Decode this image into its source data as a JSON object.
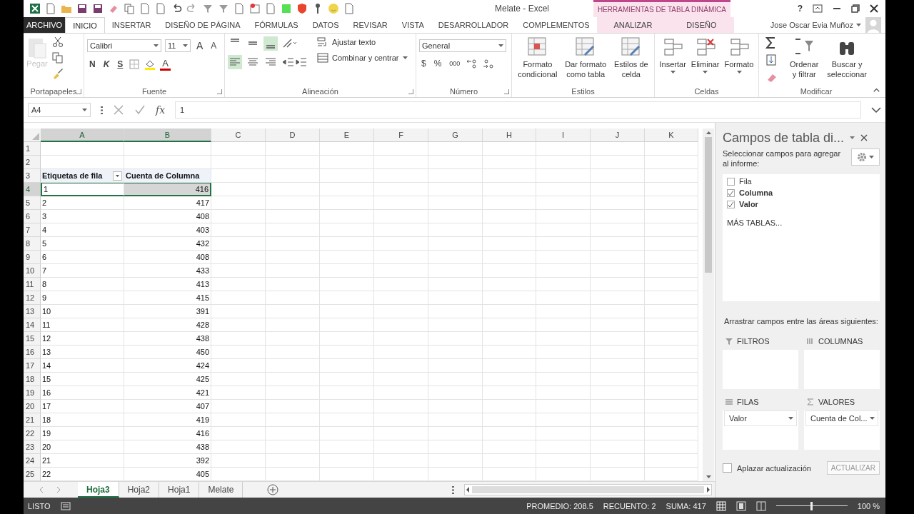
{
  "title_bar": {
    "title": "Melate - Excel",
    "context_group": "HERRAMIENTAS DE TABLA DINÁMICA",
    "help": "?"
  },
  "tabs": [
    {
      "label": "ARCHIVO",
      "kind": "file",
      "selected": false
    },
    {
      "label": "INICIO",
      "kind": "tab",
      "selected": true
    },
    {
      "label": "INSERTAR",
      "kind": "tab",
      "selected": false
    },
    {
      "label": "DISEÑO DE PÁGINA",
      "kind": "tab",
      "selected": false
    },
    {
      "label": "FÓRMULAS",
      "kind": "tab",
      "selected": false
    },
    {
      "label": "DATOS",
      "kind": "tab",
      "selected": false
    },
    {
      "label": "REVISAR",
      "kind": "tab",
      "selected": false
    },
    {
      "label": "VISTA",
      "kind": "tab",
      "selected": false
    },
    {
      "label": "DESARROLLADOR",
      "kind": "tab",
      "selected": false
    },
    {
      "label": "COMPLEMENTOS",
      "kind": "tab",
      "selected": false
    },
    {
      "label": "ANALIZAR",
      "kind": "contextual",
      "selected": false
    },
    {
      "label": "DISEÑO",
      "kind": "contextual",
      "selected": false
    }
  ],
  "user": "Jose Oscar Evia Muñoz",
  "ribbon": {
    "clipboard": {
      "label": "Portapapeles",
      "paste": "Pegar",
      "paste_disabled": true
    },
    "font": {
      "label": "Fuente",
      "family": "Calibri",
      "size": "11",
      "grow": "A",
      "shrink": "A",
      "bold": "N",
      "italic": "K",
      "underline": "S",
      "font_color_letter": "A"
    },
    "alignment": {
      "label": "Alineación",
      "wrap": "Ajustar texto",
      "merge": "Combinar y centrar",
      "vertical": [
        {
          "selected": false
        },
        {
          "selected": false
        },
        {
          "selected": true
        }
      ],
      "horizontal": [
        {
          "selected": true
        },
        {
          "selected": false
        },
        {
          "selected": false
        }
      ]
    },
    "number": {
      "label": "Número",
      "format": "General",
      "currency": "$",
      "percent": "%",
      "thousands": "000"
    },
    "styles": {
      "label": "Estilos",
      "buttons": [
        {
          "lines": [
            "Formato",
            "condicional"
          ]
        },
        {
          "lines": [
            "Dar formato",
            "como tabla"
          ]
        },
        {
          "lines": [
            "Estilos de",
            "celda"
          ]
        }
      ]
    },
    "cells": {
      "label": "Celdas",
      "buttons": [
        {
          "lines": [
            "Insertar"
          ]
        },
        {
          "lines": [
            "Eliminar"
          ]
        },
        {
          "lines": [
            "Formato"
          ]
        }
      ]
    },
    "editing": {
      "label": "Modificar",
      "buttons": [
        {
          "lines": [
            "Ordenar",
            "y filtrar"
          ]
        },
        {
          "lines": [
            "Buscar y",
            "seleccionar"
          ]
        }
      ]
    }
  },
  "formula_bar": {
    "name_box": "A4",
    "fx": "fx",
    "value": "1"
  },
  "grid": {
    "columns": [
      {
        "label": "A",
        "selected": true
      },
      {
        "label": "B",
        "selected": true
      },
      {
        "label": "C",
        "selected": false
      },
      {
        "label": "D",
        "selected": false
      },
      {
        "label": "E",
        "selected": false
      },
      {
        "label": "F",
        "selected": false
      },
      {
        "label": "G",
        "selected": false
      },
      {
        "label": "H",
        "selected": false
      },
      {
        "label": "I",
        "selected": false
      },
      {
        "label": "J",
        "selected": false
      },
      {
        "label": "K",
        "selected": false
      }
    ],
    "rows": [
      {
        "number": "1",
        "selected": false
      },
      {
        "number": "2",
        "selected": false
      },
      {
        "number": "3",
        "selected": false,
        "kind": "header",
        "cells": [
          "Etiquetas de fila",
          "Cuenta de Columna"
        ]
      },
      {
        "number": "4",
        "selected": true,
        "cells": [
          "1",
          "416"
        ]
      },
      {
        "number": "5",
        "selected": false,
        "cells": [
          "2",
          "417"
        ]
      },
      {
        "number": "6",
        "selected": false,
        "cells": [
          "3",
          "408"
        ]
      },
      {
        "number": "7",
        "selected": false,
        "cells": [
          "4",
          "403"
        ]
      },
      {
        "number": "8",
        "selected": false,
        "cells": [
          "5",
          "432"
        ]
      },
      {
        "number": "9",
        "selected": false,
        "cells": [
          "6",
          "408"
        ]
      },
      {
        "number": "10",
        "selected": false,
        "cells": [
          "7",
          "433"
        ]
      },
      {
        "number": "11",
        "selected": false,
        "cells": [
          "8",
          "413"
        ]
      },
      {
        "number": "12",
        "selected": false,
        "cells": [
          "9",
          "415"
        ]
      },
      {
        "number": "13",
        "selected": false,
        "cells": [
          "10",
          "391"
        ]
      },
      {
        "number": "14",
        "selected": false,
        "cells": [
          "11",
          "428"
        ]
      },
      {
        "number": "15",
        "selected": false,
        "cells": [
          "12",
          "438"
        ]
      },
      {
        "number": "16",
        "selected": false,
        "cells": [
          "13",
          "450"
        ]
      },
      {
        "number": "17",
        "selected": false,
        "cells": [
          "14",
          "424"
        ]
      },
      {
        "number": "18",
        "selected": false,
        "cells": [
          "15",
          "425"
        ]
      },
      {
        "number": "19",
        "selected": false,
        "cells": [
          "16",
          "421"
        ]
      },
      {
        "number": "20",
        "selected": false,
        "cells": [
          "17",
          "407"
        ]
      },
      {
        "number": "21",
        "selected": false,
        "cells": [
          "18",
          "419"
        ]
      },
      {
        "number": "22",
        "selected": false,
        "cells": [
          "19",
          "416"
        ]
      },
      {
        "number": "23",
        "selected": false,
        "cells": [
          "20",
          "438"
        ]
      },
      {
        "number": "24",
        "selected": false,
        "cells": [
          "21",
          "392"
        ]
      },
      {
        "number": "25",
        "selected": false,
        "cells": [
          "22",
          "405"
        ]
      }
    ]
  },
  "pivot_pane": {
    "title": "Campos de tabla di...",
    "subtitle": "Seleccionar campos para agregar al informe:",
    "fields": [
      {
        "label": "Fila",
        "checked": false
      },
      {
        "label": "Columna",
        "checked": true
      },
      {
        "label": "Valor",
        "checked": true
      }
    ],
    "more_tables": "MÁS TABLAS...",
    "areas_hint": "Arrastrar campos entre las áreas siguientes:",
    "areas": [
      {
        "kind": "filter",
        "label": "FILTROS"
      },
      {
        "kind": "columns",
        "label": "COLUMNAS"
      },
      {
        "kind": "rows",
        "label": "FILAS",
        "items": [
          "Valor"
        ]
      },
      {
        "kind": "values",
        "label": "VALORES",
        "items": [
          "Cuenta de Col..."
        ]
      }
    ],
    "defer": {
      "label": "Aplazar actualización",
      "checked": false
    },
    "update": "ACTUALIZAR"
  },
  "sheets": [
    {
      "label": "Hoja3",
      "selected": true
    },
    {
      "label": "Hoja2",
      "selected": false
    },
    {
      "label": "Hoja1",
      "selected": false
    },
    {
      "label": "Melate",
      "selected": false
    }
  ],
  "status_bar": {
    "mode": "LISTO",
    "stats": [
      "PROMEDIO: 208.5",
      "RECUENTO: 2",
      "SUMA: 417"
    ],
    "zoom": "100 %",
    "level": 0.5
  }
}
